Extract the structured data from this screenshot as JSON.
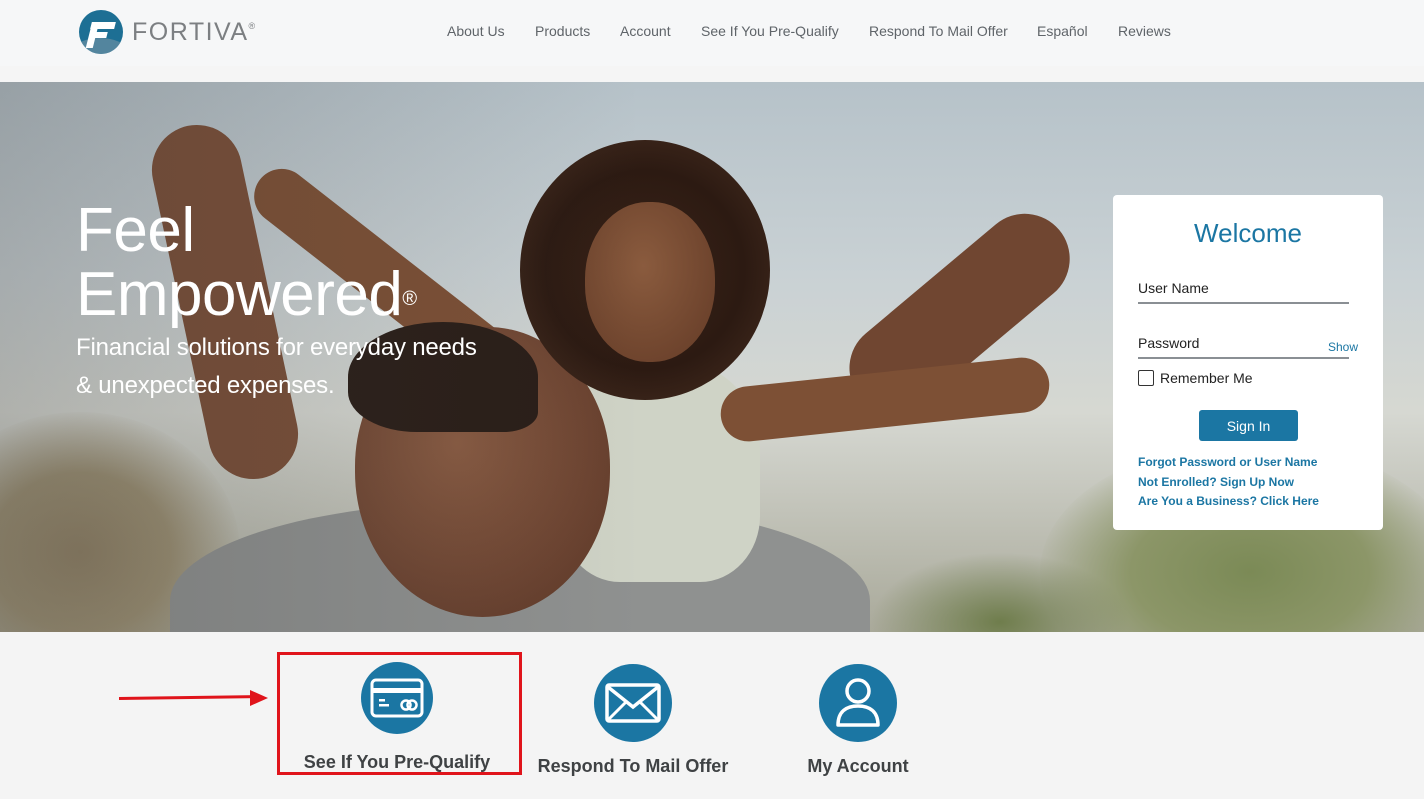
{
  "header": {
    "logo_text": "FORTIVA",
    "logo_reg": "®",
    "nav": [
      "About Us",
      "Products",
      "Account",
      "See If You Pre-Qualify",
      "Respond To Mail Offer",
      "Español",
      "Reviews"
    ]
  },
  "hero": {
    "title_line1": "Feel",
    "title_line2": "Empowered",
    "title_reg": "®",
    "subtitle_line1": "Financial solutions for everyday needs",
    "subtitle_line2": "& unexpected expenses."
  },
  "login": {
    "title": "Welcome",
    "username_label": "User Name",
    "password_label": "Password",
    "show_label": "Show",
    "remember_label": "Remember Me",
    "signin_label": "Sign In",
    "links": [
      "Forgot Password or User Name",
      "Not Enrolled? Sign Up Now",
      "Are You a Business? Click Here"
    ]
  },
  "tiles": [
    {
      "label": "See If You Pre-Qualify",
      "icon": "credit-card-icon"
    },
    {
      "label": "Respond To Mail Offer",
      "icon": "envelope-icon"
    },
    {
      "label": "My Account",
      "icon": "user-icon"
    }
  ],
  "colors": {
    "brand_blue": "#1b76a3",
    "annotation_red": "#e0141b"
  }
}
